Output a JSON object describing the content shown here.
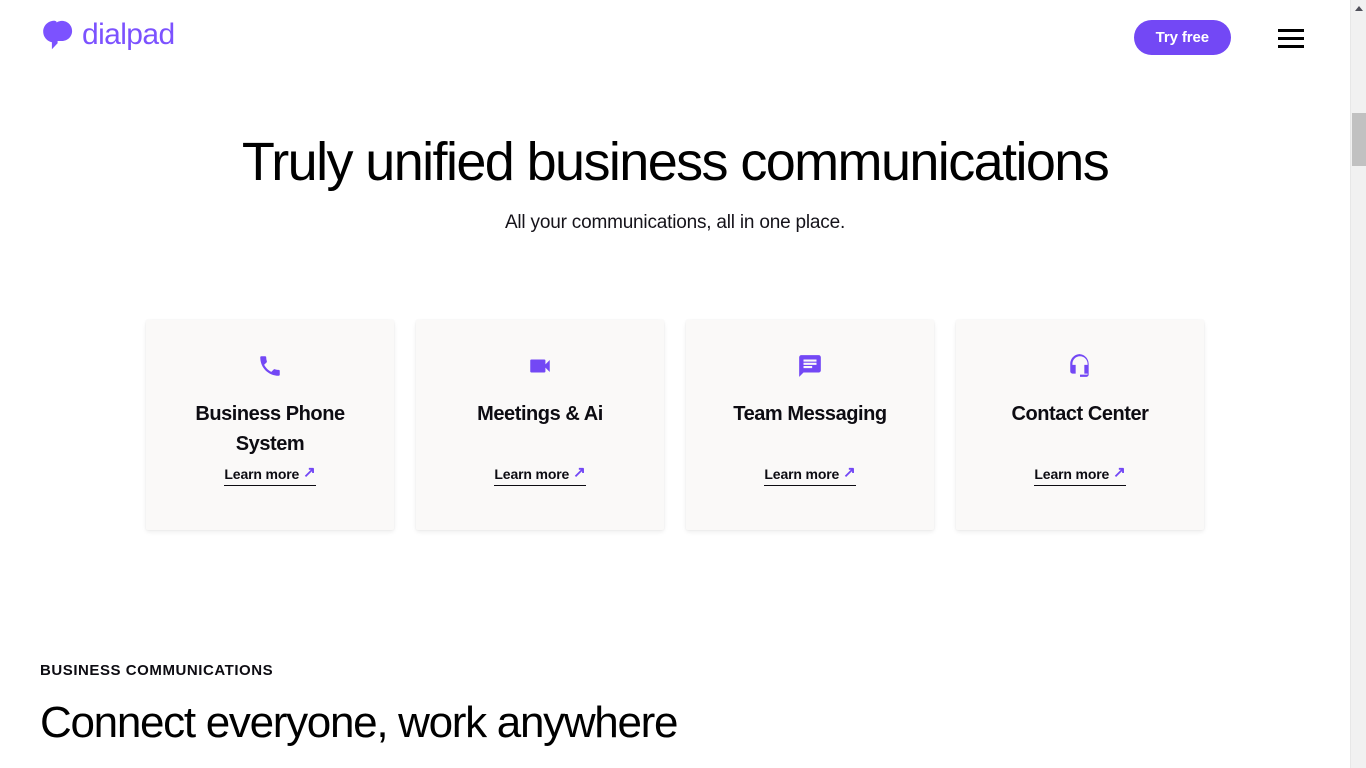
{
  "brand": {
    "name": "dialpad",
    "logo_icon": "dialpad-logo-mark",
    "color": "#7c52ff"
  },
  "header": {
    "try_free_label": "Try free",
    "try_free_color": "#7348f5",
    "menu_icon": "hamburger-menu-icon"
  },
  "hero": {
    "title": "Truly unified business communications",
    "subtitle": "All your communications, all in one place."
  },
  "cards": [
    {
      "icon": "phone-icon",
      "title": "Business Phone System",
      "link_label": "Learn more",
      "link_arrow": "↗"
    },
    {
      "icon": "video-camera-icon",
      "title": "Meetings & Ai",
      "link_label": "Learn more",
      "link_arrow": "↗"
    },
    {
      "icon": "chat-bubble-icon",
      "title": "Team Messaging",
      "link_label": "Learn more",
      "link_arrow": "↗"
    },
    {
      "icon": "headset-icon",
      "title": "Contact Center",
      "link_label": "Learn more",
      "link_arrow": "↗"
    }
  ],
  "lower_section": {
    "eyebrow": "BUSINESS COMMUNICATIONS",
    "heading": "Connect everyone, work anywhere"
  },
  "scrollbar": {
    "up_arrow_icon": "scroll-up-arrow-icon",
    "thumb_icon": "scrollbar-thumb"
  }
}
